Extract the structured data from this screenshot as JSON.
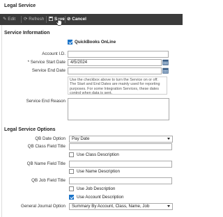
{
  "page": {
    "title": "Legal Service"
  },
  "toolbar": {
    "edit": "Edit",
    "refresh": "Refresh",
    "save": "Save",
    "cancel": "Cancel"
  },
  "service_info": {
    "heading": "Service Information",
    "quickbooks_label": "QuickBooks OnLine",
    "quickbooks_checked": true,
    "account_id_label": "Account I.D.",
    "account_id_value": "",
    "start_date_label": "* Service Start Date",
    "start_date_value": "4/5/2024",
    "end_date_label": "Service End Date",
    "end_date_value": "",
    "help_text": "Use the checkbox above to turn the Service on or off. The Start and End Dates are mainly used for reporting purposes. For some Integration Services, these dates control when data is sent.",
    "end_reason_label": "Service End Reason",
    "end_reason_value": ""
  },
  "options": {
    "heading": "Legal Service Options",
    "qb_date_label": "QB Date Option",
    "qb_date_value": "Pay Date",
    "class_title_label": "QB Class Field Title",
    "class_title_value": "",
    "use_class_desc_label": "Use Class Description",
    "use_class_desc_checked": false,
    "name_title_label": "QB Name Field Title",
    "name_title_value": "",
    "use_name_desc_label": "Use Name Description",
    "use_name_desc_checked": false,
    "job_title_label": "QB Job Field Title",
    "job_title_value": "",
    "use_job_desc_label": "Use Job Description",
    "use_job_desc_checked": false,
    "use_account_desc_label": "Use Account Description",
    "use_account_desc_checked": true,
    "gj_label": "General Journal Option",
    "gj_value": "Summary By Account, Class, Name, Job"
  },
  "colors": {
    "toolbar_bg": "#3b3b3b",
    "checkbox_accent": "#1a73c8",
    "calendar_icon": "#5b7fa6"
  }
}
